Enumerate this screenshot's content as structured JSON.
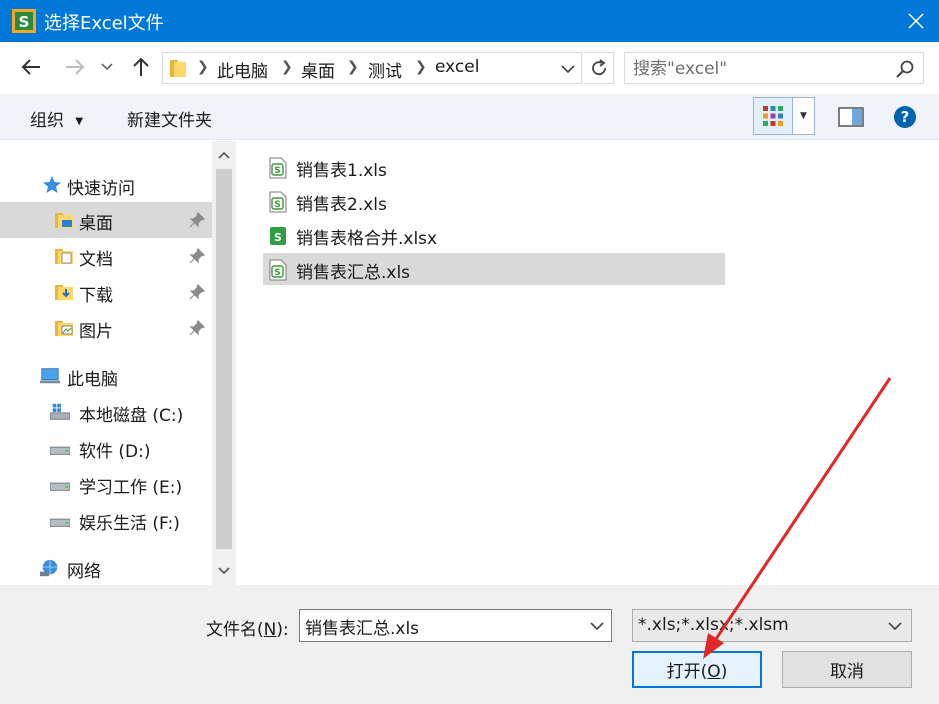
{
  "window": {
    "title": "选择Excel文件",
    "accent_color": "#0078d7"
  },
  "address": {
    "crumbs": [
      "此电脑",
      "桌面",
      "测试",
      "excel"
    ]
  },
  "search": {
    "placeholder": "搜索\"excel\""
  },
  "toolbar": {
    "organize_label": "组织",
    "new_folder_label": "新建文件夹"
  },
  "sidebar": {
    "quick_access": "快速访问",
    "items": [
      {
        "label": "桌面",
        "icon": "desktop-folder-icon",
        "pinned": true
      },
      {
        "label": "文档",
        "icon": "documents-folder-icon",
        "pinned": true
      },
      {
        "label": "下载",
        "icon": "downloads-folder-icon",
        "pinned": true
      },
      {
        "label": "图片",
        "icon": "pictures-folder-icon",
        "pinned": true
      }
    ],
    "this_pc": "此电脑",
    "drives": [
      {
        "label": "本地磁盘 (C:)",
        "icon": "windows-drive-icon"
      },
      {
        "label": "软件 (D:)",
        "icon": "drive-icon"
      },
      {
        "label": "学习工作 (E:)",
        "icon": "drive-icon"
      },
      {
        "label": "娱乐生活 (F:)",
        "icon": "drive-icon"
      }
    ],
    "network": "网络"
  },
  "files": [
    {
      "name": "销售表1.xls",
      "icon": "spreadsheet-icon"
    },
    {
      "name": "销售表2.xls",
      "icon": "spreadsheet-icon"
    },
    {
      "name": "销售表格合并.xlsx",
      "icon": "spreadsheet-xlsx-icon"
    },
    {
      "name": "销售表汇总.xls",
      "icon": "spreadsheet-icon",
      "selected": true
    }
  ],
  "bottom": {
    "filename_label_prefix": "文件名(",
    "filename_label_key": "N",
    "filename_label_suffix": "):",
    "filename_value": "销售表汇总.xls",
    "filter_value": "*.xls;*.xlsx;*.xlsm",
    "open_label_prefix": "打开(",
    "open_label_key": "O",
    "open_label_suffix": ")",
    "cancel_label": "取消"
  }
}
